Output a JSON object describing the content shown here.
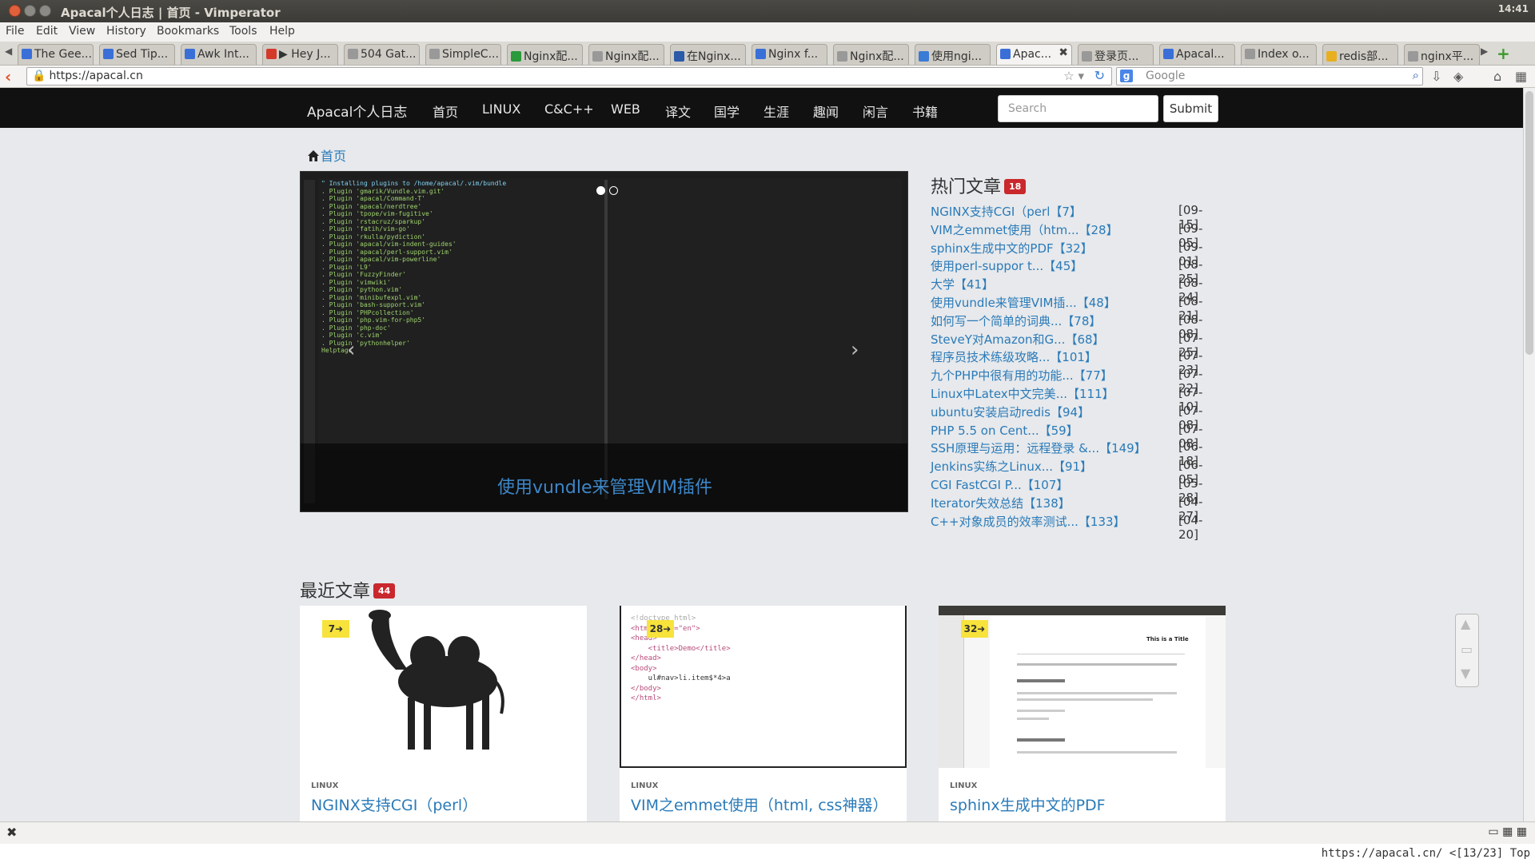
{
  "window": {
    "title": "Apacal个人日志 | 首页 - Vimperator",
    "clock": "14:41"
  },
  "menu": [
    "File",
    "Edit",
    "View",
    "History",
    "Bookmarks",
    "Tools",
    "Help"
  ],
  "tabs": [
    {
      "label": "The Gee...",
      "color": "#3a6fd8"
    },
    {
      "label": "Sed Tip...",
      "color": "#3a6fd8"
    },
    {
      "label": "Awk Int...",
      "color": "#3a6fd8"
    },
    {
      "label": "▶ Hey J...",
      "color": "#d43a2a"
    },
    {
      "label": "504 Gat...",
      "color": "#999999"
    },
    {
      "label": "SimpleC...",
      "color": "#999999"
    },
    {
      "label": "Nginx配...",
      "color": "#2a9a3a"
    },
    {
      "label": "Nginx配...",
      "color": "#999999"
    },
    {
      "label": "在Nginx...",
      "color": "#2a5aa8"
    },
    {
      "label": "Nginx f...",
      "color": "#3a6fd8"
    },
    {
      "label": "Nginx配...",
      "color": "#999999"
    },
    {
      "label": "使用ngi...",
      "color": "#3a7bd5"
    },
    {
      "label": "Apac...",
      "color": "#3a6fd8",
      "active": true
    },
    {
      "label": "登录页...",
      "color": "#999999"
    },
    {
      "label": "Apacal...",
      "color": "#3a6fd8"
    },
    {
      "label": "Index o...",
      "color": "#999999"
    },
    {
      "label": "redis部...",
      "color": "#e8b020"
    },
    {
      "label": "nginx平...",
      "color": "#999999"
    }
  ],
  "address": {
    "url": "https://apacal.cn",
    "search_placeholder": "Google"
  },
  "site": {
    "brand": "Apacal个人日志",
    "nav": [
      "首页",
      "LINUX",
      "C&C++",
      "WEB",
      "译文",
      "国学",
      "生涯",
      "趣闻",
      "闲言",
      "书籍"
    ],
    "search_placeholder": "Search",
    "submit": "Submit",
    "breadcrumb": "首页"
  },
  "carousel": {
    "caption": "使用vundle来管理VIM插件",
    "terminal_lines": [
      "\" Installing plugins to /home/apacal/.vim/bundle",
      ". Plugin 'gmarik/Vundle.vim.git'",
      ". Plugin 'apacal/Command-T'",
      ". Plugin 'apacal/nerdtree'",
      ". Plugin 'tpope/vim-fugitive'",
      ". Plugin 'rstacruz/sparkup'",
      ". Plugin 'fatih/vim-go'",
      ". Plugin 'rkulla/pydiction'",
      ". Plugin 'apacal/vim-indent-guides'",
      ". Plugin 'apacal/perl-support.vim'",
      ". Plugin 'apacal/vim-powerline'",
      ". Plugin 'L9'",
      ". Plugin 'FuzzyFinder'",
      ". Plugin 'vimwiki'",
      ". Plugin 'python.vim'",
      ". Plugin 'minibufexpl.vim'",
      ". Plugin 'bash-support.vim'",
      ". Plugin 'PHPcollection'",
      ". Plugin 'php.vim-for-php5'",
      ". Plugin 'php-doc'",
      ". Plugin 'c.vim'",
      ". Plugin 'pythonhelper'",
      "Helptags"
    ]
  },
  "hot": {
    "title": "热门文章",
    "count": "18",
    "items": [
      {
        "title": "NGINX支持CGI（perl【7】",
        "date": "[09-15]"
      },
      {
        "title": "VIM之emmet使用（htm...【28】",
        "date": "[09-05]"
      },
      {
        "title": "sphinx生成中文的PDF【32】",
        "date": "[09-01]"
      },
      {
        "title": "使用perl-suppor t...【45】",
        "date": "[08-25]"
      },
      {
        "title": "大学【41】",
        "date": "[08-24]"
      },
      {
        "title": "使用vundle来管理VIM插...【48】",
        "date": "[08-21]"
      },
      {
        "title": "如何写一个简单的词典...【78】",
        "date": "[08-08]"
      },
      {
        "title": "SteveY对Amazon和G...【68】",
        "date": "[07-25]"
      },
      {
        "title": "程序员技术练级攻略...【101】",
        "date": "[07-23]"
      },
      {
        "title": "九个PHP中很有用的功能...【77】",
        "date": "[07-22]"
      },
      {
        "title": "Linux中Latex中文完美...【111】",
        "date": "[07-10]"
      },
      {
        "title": "ubuntu安装启动redis【94】",
        "date": "[07-08]"
      },
      {
        "title": "PHP 5.5 on Cent...【59】",
        "date": "[07-08]"
      },
      {
        "title": "SSH原理与运用：远程登录 &...【149】",
        "date": "[06-18]"
      },
      {
        "title": "Jenkins实练之Linux...【91】",
        "date": "[06-05]"
      },
      {
        "title": "CGI FastCGI P...【107】",
        "date": "[05-28]"
      },
      {
        "title": "Iterator失效总结【138】",
        "date": "[04-27]"
      },
      {
        "title": "C++对象成员的效率测试...【133】",
        "date": "[04-20]"
      }
    ]
  },
  "recent": {
    "title": "最近文章",
    "count": "44",
    "cards": [
      {
        "badge": "7➜",
        "category": "LINUX",
        "title": "NGINX支持CGI（perl）"
      },
      {
        "badge": "28➜",
        "category": "LINUX",
        "title": "VIM之emmet使用（html, css神器）"
      },
      {
        "badge": "32➜",
        "category": "LINUX",
        "title": "sphinx生成中文的PDF"
      }
    ],
    "code_snippet": [
      "<!doctype html>",
      "<html lang=\"en\">",
      "<head>",
      "    <title>Demo</title>",
      "</head>",
      "<body>",
      "    ul#nav>li.item$*4>a",
      "</body>",
      "</html>"
    ],
    "doc_title": "This is a Title"
  },
  "status": {
    "text": "https://apacal.cn/ <[13/23] Top"
  }
}
